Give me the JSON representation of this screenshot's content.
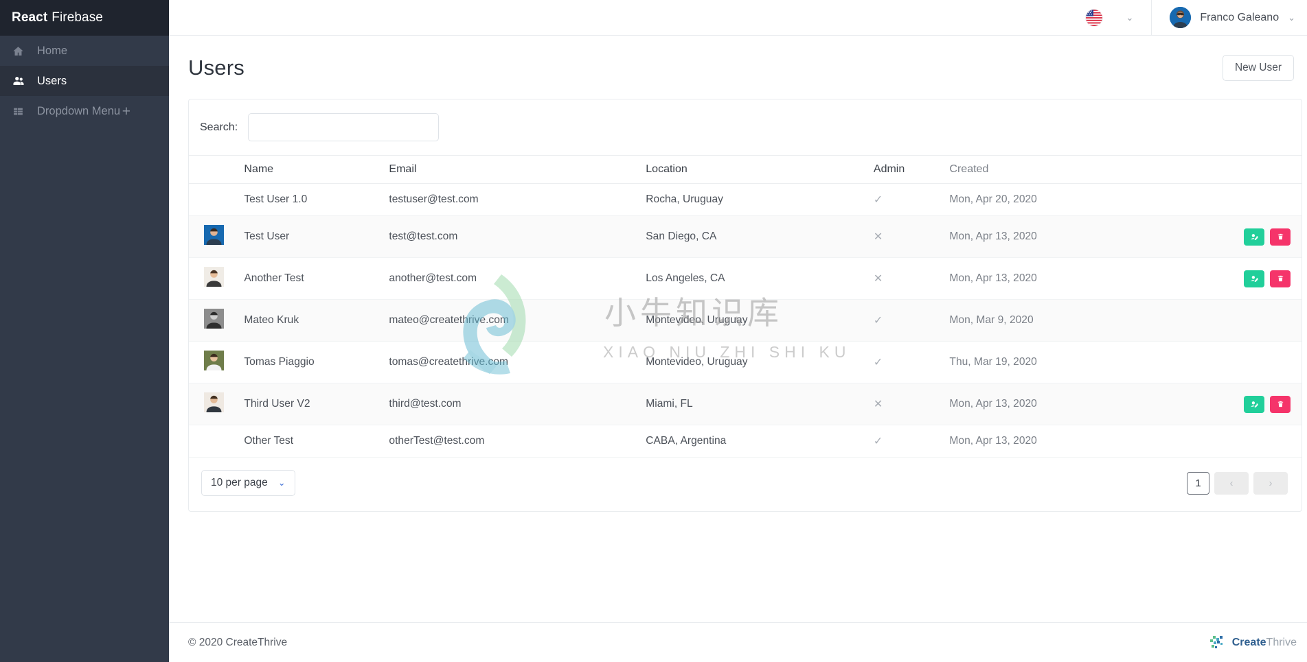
{
  "sidebar": {
    "brand_strong": "React",
    "brand_light": "Firebase",
    "items": [
      {
        "label": "Home",
        "icon": "home-icon",
        "active": false,
        "plus": false
      },
      {
        "label": "Users",
        "icon": "users-icon",
        "active": true,
        "plus": false
      },
      {
        "label": "Dropdown Menu",
        "icon": "list-icon",
        "active": false,
        "plus": true,
        "plus_label": "+"
      }
    ]
  },
  "topbar": {
    "language_icon": "us-flag-icon",
    "language_chevron": "⌄",
    "user_name": "Franco Galeano",
    "user_chevron": "⌄"
  },
  "page": {
    "title": "Users",
    "new_user_label": "New User"
  },
  "search": {
    "label": "Search:",
    "value": "",
    "placeholder": ""
  },
  "table": {
    "columns": [
      "",
      "Name",
      "Email",
      "Location",
      "Admin",
      "Created",
      ""
    ],
    "admin_true_glyph": "✓",
    "admin_false_glyph": "✕",
    "rows": [
      {
        "avatar": false,
        "name": "Test User 1.0",
        "email": "testuser@test.com",
        "location": "Rocha, Uruguay",
        "admin": true,
        "created": "Mon, Apr 20, 2020",
        "actions": false
      },
      {
        "avatar": true,
        "name": "Test User",
        "email": "test@test.com",
        "location": "San Diego, CA",
        "admin": false,
        "created": "Mon, Apr 13, 2020",
        "actions": true
      },
      {
        "avatar": true,
        "name": "Another Test",
        "email": "another@test.com",
        "location": "Los Angeles, CA",
        "admin": false,
        "created": "Mon, Apr 13, 2020",
        "actions": true
      },
      {
        "avatar": true,
        "name": "Mateo Kruk",
        "email": "mateo@createthrive.com",
        "location": "Montevideo, Uruguay",
        "admin": true,
        "created": "Mon, Mar 9, 2020",
        "actions": false
      },
      {
        "avatar": true,
        "name": "Tomas Piaggio",
        "email": "tomas@createthrive.com",
        "location": "Montevideo, Uruguay",
        "admin": true,
        "created": "Thu, Mar 19, 2020",
        "actions": false
      },
      {
        "avatar": true,
        "name": "Third User V2",
        "email": "third@test.com",
        "location": "Miami, FL",
        "admin": false,
        "created": "Mon, Apr 13, 2020",
        "actions": true
      },
      {
        "avatar": false,
        "name": "Other Test",
        "email": "otherTest@test.com",
        "location": "CABA, Argentina",
        "admin": true,
        "created": "Mon, Apr 13, 2020",
        "actions": false
      }
    ]
  },
  "pagination": {
    "per_page_label": "10 per page",
    "per_page_chevron": "⌄",
    "current_page": "1",
    "prev_glyph": "‹",
    "next_glyph": "›"
  },
  "footer": {
    "copyright": "© 2020  CreateThrive",
    "logo_create": "Create",
    "logo_thrive": "Thrive"
  },
  "watermark": {
    "text_cn": "小牛知识库",
    "text_py": "XIAO NIU ZHI SHI KU"
  },
  "colors": {
    "sidebar_bg": "#323a49",
    "brand_bg": "#1f242e",
    "active_bg": "#2b313d",
    "edit_green": "#21cf9a",
    "delete_red": "#f5346a",
    "accent_blue": "#3d6fd6"
  }
}
